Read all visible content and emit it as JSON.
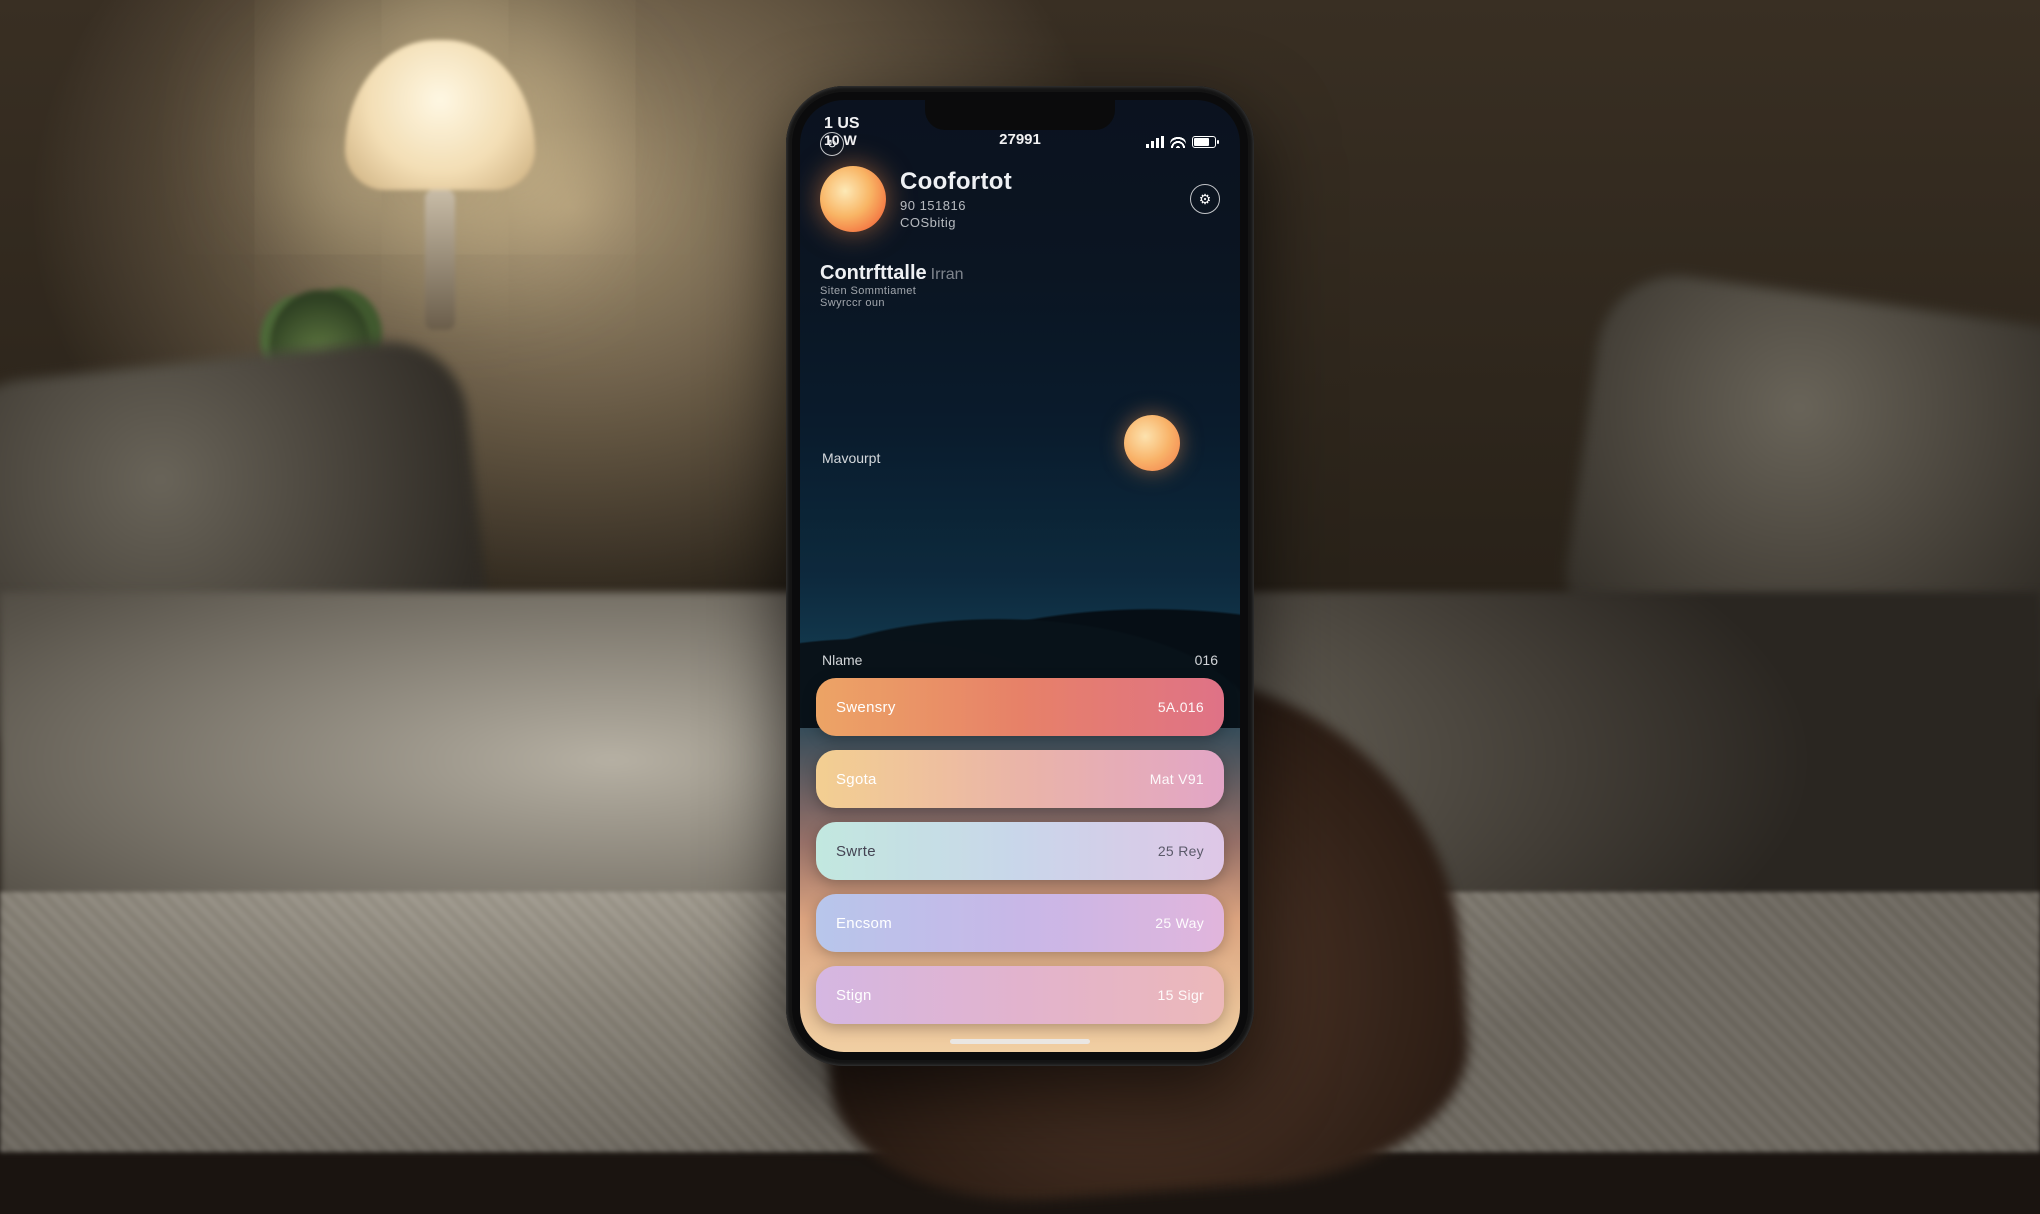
{
  "statusbar": {
    "left1": "1 US",
    "left2": "10 W",
    "center": "27991",
    "icons": [
      "signal",
      "wifi",
      "battery"
    ]
  },
  "header": {
    "refresh_icon": "↻",
    "title": "Coofortot",
    "sub1": "90 151816",
    "sub2": "COSbitig",
    "settings_icon": "⚙",
    "section_title": "Contrfttalle",
    "section_suffix": "Irran",
    "section_line1": "Siten Sommtiamet",
    "section_line2": "Swyrccr oun"
  },
  "mid_label": "Mavourpt",
  "list_header": {
    "left": "Nlame",
    "right": "016"
  },
  "rows": [
    {
      "label": "Swensry",
      "value": "5A.016"
    },
    {
      "label": "Sgota",
      "value": "Mat V91"
    },
    {
      "label": "Swrte",
      "value": "25 Rey"
    },
    {
      "label": "Encsom",
      "value": "25 Way"
    },
    {
      "label": "Stign",
      "value": "15 Sigr"
    }
  ],
  "colors": {
    "accent": "#ff8a4a",
    "pill_gradients": [
      "#f3a35d",
      "#f7cf8a",
      "#bfe9df",
      "#b6c6ef",
      "#d7b6e6"
    ]
  }
}
